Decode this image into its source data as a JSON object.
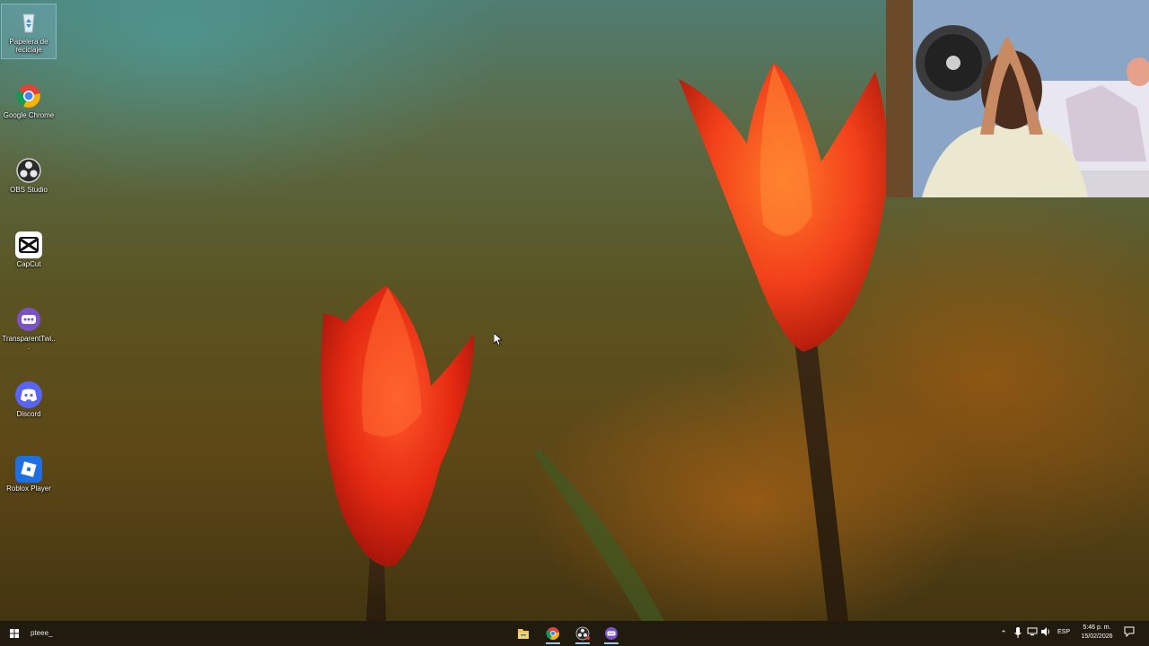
{
  "desktop": {
    "icons": [
      {
        "label": "Papelera de reciclaje",
        "icon": "recycle-bin-icon"
      },
      {
        "label": "Google Chrome",
        "icon": "chrome-icon"
      },
      {
        "label": "OBS Studio",
        "icon": "obs-icon"
      },
      {
        "label": "CapCut",
        "icon": "capcut-icon"
      },
      {
        "label": "TransparentTwi...",
        "icon": "transparent-twitch-icon"
      },
      {
        "label": "Discord",
        "icon": "discord-icon"
      },
      {
        "label": "Roblox Player",
        "icon": "roblox-icon"
      }
    ]
  },
  "taskbar": {
    "search_text": "pteee_",
    "pinned_apps": [
      {
        "name": "File Explorer",
        "icon": "folder-icon",
        "active": false
      },
      {
        "name": "Google Chrome",
        "icon": "chrome-icon",
        "active": true
      },
      {
        "name": "OBS Studio",
        "icon": "obs-icon",
        "active": true
      },
      {
        "name": "TransparentTwitchChat",
        "icon": "transparent-twitch-icon",
        "active": true
      }
    ],
    "tray": {
      "language": "ESP",
      "time": "5:46 p. m.",
      "date": "15/02/2026"
    }
  },
  "colors": {
    "chrome_red": "#db4437",
    "chrome_yellow": "#f4b400",
    "chrome_green": "#0f9d58",
    "chrome_blue": "#4285f4",
    "discord": "#5865f2",
    "twitch_purple": "#7b52c9",
    "roblox_blue": "#1f6fe0",
    "taskbar": "#1e180e"
  }
}
